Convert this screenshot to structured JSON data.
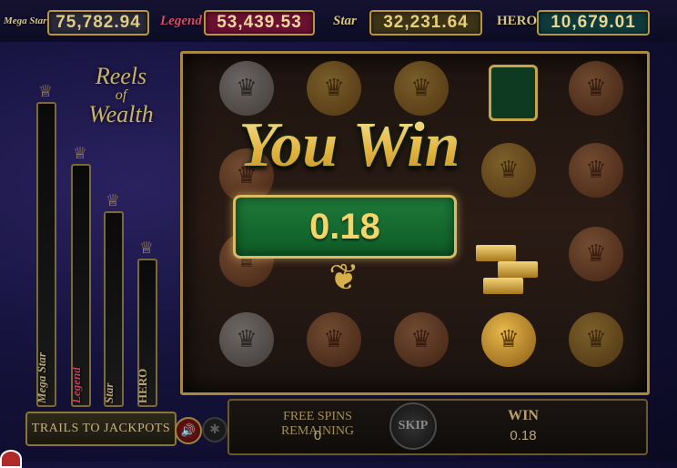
{
  "jackpots": [
    {
      "name": "Mega Star",
      "value": "75,782.94"
    },
    {
      "name": "Legend",
      "value": "53,439.53"
    },
    {
      "name": "Star",
      "value": "32,231.64"
    },
    {
      "name": "HERO",
      "value": "10,679.01"
    }
  ],
  "logo": {
    "line1": "Reels",
    "line2": "of",
    "line3": "Wealth"
  },
  "trails": [
    {
      "name": "Mega Star"
    },
    {
      "name": "Legend"
    },
    {
      "name": "Star"
    },
    {
      "name": "HERO"
    }
  ],
  "trails_button": "TRAILS TO JACKPOTS",
  "win_popup": {
    "title": "You Win",
    "amount": "0.18"
  },
  "bottom_bar": {
    "free_spins_label": "FREE SPINS REMAINING",
    "free_spins_value": "0",
    "skip_label": "SKIP",
    "win_label": "WIN",
    "win_value": "0.18"
  },
  "icons": {
    "sound": "speaker-icon",
    "settings": "settings-icon"
  },
  "colors": {
    "frame_gold": "#a8893e",
    "win_green": "#1e7a3a",
    "win_text": "#f3d56a"
  }
}
